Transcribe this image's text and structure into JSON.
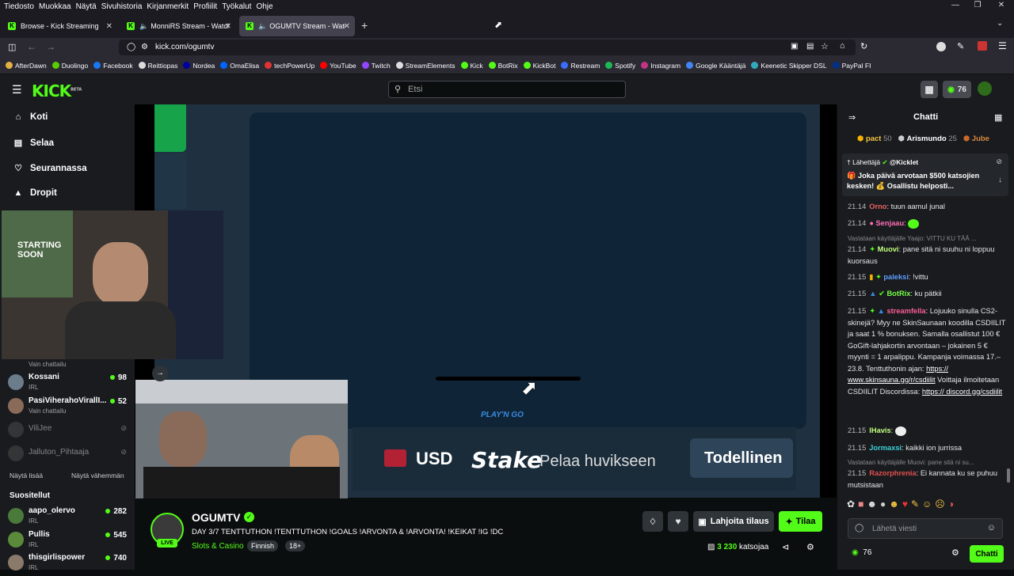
{
  "menubar": [
    "Tiedosto",
    "Muokkaa",
    "Näytä",
    "Sivuhistoria",
    "Kirjanmerkit",
    "Profiilit",
    "Työkalut",
    "Ohje"
  ],
  "tabs": [
    {
      "title": "Browse - Kick Streaming"
    },
    {
      "title": "MonniRS Stream - Watch Li"
    },
    {
      "title": "OGUMTV Stream - Watch L"
    }
  ],
  "url": "kick.com/ogumtv",
  "bookmarks": [
    "AfterDawn",
    "Duolingo",
    "Facebook",
    "Reittiopas",
    "Nordea",
    "OmaElisa",
    "techPowerUp",
    "YouTube",
    "Twitch",
    "StreamElements",
    "Kick",
    "BotRix",
    "KickBot",
    "Restream",
    "Spotify",
    "Instagram",
    "Google Kääntäjä",
    "Keenetic Skipper DSL",
    "PayPal FI"
  ],
  "header": {
    "logo": "KICK",
    "logo_sup": "BETA",
    "search_placeholder": "Etsi",
    "points": "76"
  },
  "sidebar": {
    "nav": [
      {
        "label": "Koti"
      },
      {
        "label": "Selaa"
      },
      {
        "label": "Seurannassa"
      },
      {
        "label": "Dropit"
      }
    ],
    "following": [
      {
        "name": "",
        "sub": "Vain chattailu",
        "viewers": ""
      },
      {
        "name": "Kossani",
        "sub": "IRL",
        "viewers": "98"
      },
      {
        "name": "PasiViherahoVirallI...",
        "sub": "Vain chattailu",
        "viewers": "52"
      },
      {
        "name": "ViliJee",
        "sub": "",
        "viewers": ""
      },
      {
        "name": "Jalluton_Pihtaaja",
        "sub": "",
        "viewers": ""
      }
    ],
    "show_more": "Näytä lisää",
    "show_less": "Näytä vähemmän",
    "recommended_title": "Suositellut",
    "recommended": [
      {
        "name": "aapo_olervo",
        "sub": "IRL",
        "viewers": "282"
      },
      {
        "name": "Pullis",
        "sub": "IRL",
        "viewers": "545"
      },
      {
        "name": "thisgirlispower",
        "sub": "IRL",
        "viewers": "740"
      }
    ]
  },
  "video": {
    "banner_usd": "USD",
    "banner_stake": "Stake",
    "banner_play": "Pelaa huvikseen",
    "banner_real": "Todellinen",
    "playngo": "PLAY'N GO",
    "webcam_text": "STARTING SOON"
  },
  "stream": {
    "name": "OGUMTV",
    "live": "LIVE",
    "title": "DAY 3/7 TENTTUTHON !TENTTUTHON !GOALS !ARVONTA & !ARVONTA! !KEIKAT !IG !DC",
    "category": "Slots & Casino",
    "tags": [
      "Finnish",
      "18+"
    ],
    "gift_label": "Lahjoita tilaus",
    "sub_label": "Tilaa",
    "viewers": "3 230",
    "viewers_label": "katsojaa"
  },
  "chat": {
    "title": "Chatti",
    "top": [
      {
        "name": "pact",
        "n": "50"
      },
      {
        "name": "Arismundo",
        "n": "25"
      },
      {
        "name": "Jube",
        "n": ""
      }
    ],
    "pinned_by": "Lähettäjä",
    "pinned_user": "@Kicklet",
    "pinned_text": "🎁 Joka päivä arvotaan $500 katsojien kesken! 💰 Osallistu helposti...",
    "messages": [
      {
        "time": "21.14",
        "user": "Orno",
        "color": "#e86161",
        "text": "tuun aamul junal"
      },
      {
        "time": "21.14",
        "user": "Senjaau",
        "color": "#ff6fb5",
        "text": ""
      },
      {
        "time": "21.14",
        "user": "Muovi",
        "color": "#c3ff7d",
        "text": "pane sitä ni suuhu ni loppuu kuorsaus",
        "reply": "Vastataan käyttäjälle Yaajo: VITTU KU TÄÄ ..."
      },
      {
        "time": "21.15",
        "user": "paleksi",
        "color": "#5e9fff",
        "text": "!vittu"
      },
      {
        "time": "21.15",
        "user": "BotRix",
        "color": "#75fd46",
        "text": "ku pätkii"
      },
      {
        "time": "21.15",
        "user": "streamfella",
        "color": "#ff5e94",
        "text": "Lojuuko sinulla CS2-skinejä? Myy ne SkinSaunaan koodilla CSDIILIT ja saat 1 % bonuksen. Samalla osallistut 100 € GoGift-lahjakortin arvontaan – jokainen 5 € myynti = 1 arpalippu. Kampanja voimassa 17.–23.8. Tenttuthonin ajan: ",
        "link1": "https:// www.skinsauna.gg/r/csdiilit",
        "text2": " Voittaja ilmoitetaan CSDIILIT Discordissa: ",
        "link2": "https:// discord.gg/csdiilit"
      },
      {
        "time": "21.15",
        "user": "IHavis",
        "color": "#c3ff7d",
        "text": ""
      },
      {
        "time": "21.15",
        "user": "Jormaxsi",
        "color": "#3bd0d6",
        "text": "kaikki ion jurrissa"
      },
      {
        "time": "21.15",
        "user": "Razorphrenia",
        "color": "#e44f4f",
        "text": "Ei kannata ku se puhuu mutsistaan",
        "reply": "Vastataan käyttäjälle Muovi: pane sitä ni su..."
      }
    ],
    "input_placeholder": "Lähetä viesti",
    "points": "76",
    "send_label": "Chatti"
  },
  "colors": {
    "kick_green": "#53fc18",
    "bg": "#0b0e0f",
    "panel": "#191b1f"
  }
}
